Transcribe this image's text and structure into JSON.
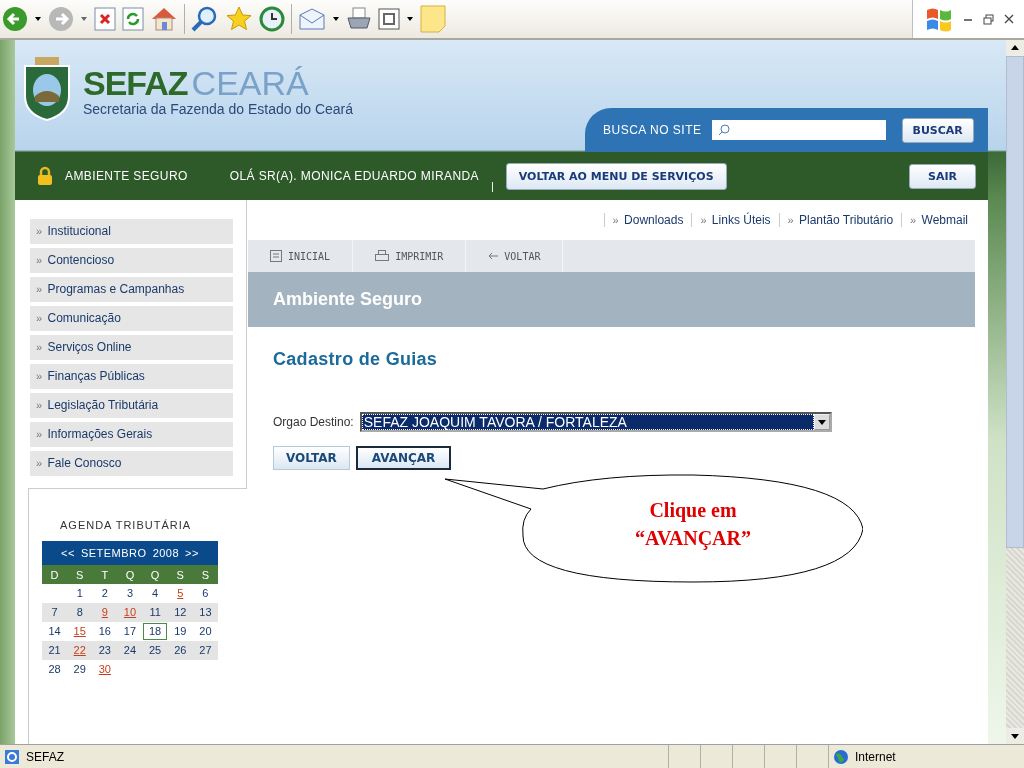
{
  "browser": {
    "status_text": "SEFAZ",
    "zone": "Internet"
  },
  "header": {
    "brand_bold": "SEFAZ",
    "brand_light": "CEARÁ",
    "subtitle": "Secretaria da Fazenda do Estado do Ceará",
    "search_label": "BUSCA NO SITE",
    "search_button": "BUSCAR"
  },
  "user_bar": {
    "secure_label": "AMBIENTE SEGURO",
    "greeting": "OLÁ SR(A). MONICA EDUARDO MIRANDA",
    "separator": "|",
    "menu_button": "VOLTAR AO MENU DE SERVIÇOS",
    "exit_button": "SAIR"
  },
  "sidebar": {
    "items": [
      {
        "marker": "»",
        "label": "Institucional"
      },
      {
        "marker": "»",
        "label": "Contencioso"
      },
      {
        "marker": "»",
        "label": "Programas e Campanhas"
      },
      {
        "marker": "»",
        "label": "Comunicação"
      },
      {
        "marker": "»",
        "label": "Serviços Online"
      },
      {
        "marker": "»",
        "label": "Finanças Públicas"
      },
      {
        "marker": "»",
        "label": "Legislação Tributária"
      },
      {
        "marker": "»",
        "label": "Informações Gerais"
      },
      {
        "marker": "»",
        "label": "Fale Conosco"
      }
    ]
  },
  "agenda": {
    "title": "AGENDA TRIBUTÁRIA",
    "prev": "<<",
    "month": "SETEMBRO",
    "year": "2008",
    "next": ">>",
    "weekdays": [
      "D",
      "S",
      "T",
      "Q",
      "Q",
      "S",
      "S"
    ],
    "weeks": [
      {
        "partial_start": true,
        "days": [
          {
            "day": "1",
            "marked": false,
            "today": false
          },
          {
            "day": "2",
            "marked": false,
            "today": false
          },
          {
            "day": "3",
            "marked": false,
            "today": false
          },
          {
            "day": "4",
            "marked": false,
            "today": false
          },
          {
            "day": "5",
            "marked": true,
            "today": false
          },
          {
            "day": "6",
            "marked": false,
            "today": false
          }
        ]
      },
      {
        "partial_start": false,
        "days": [
          {
            "day": "7",
            "marked": false,
            "today": false
          },
          {
            "day": "8",
            "marked": false,
            "today": false
          },
          {
            "day": "9",
            "marked": true,
            "today": false
          },
          {
            "day": "10",
            "marked": true,
            "today": false
          },
          {
            "day": "11",
            "marked": false,
            "today": false
          },
          {
            "day": "12",
            "marked": false,
            "today": false
          },
          {
            "day": "13",
            "marked": false,
            "today": false
          }
        ]
      },
      {
        "partial_start": false,
        "days": [
          {
            "day": "14",
            "marked": false,
            "today": false
          },
          {
            "day": "15",
            "marked": true,
            "today": false
          },
          {
            "day": "16",
            "marked": false,
            "today": false
          },
          {
            "day": "17",
            "marked": false,
            "today": false
          },
          {
            "day": "18",
            "marked": false,
            "today": true
          },
          {
            "day": "19",
            "marked": false,
            "today": false
          },
          {
            "day": "20",
            "marked": false,
            "today": false
          }
        ]
      },
      {
        "partial_start": false,
        "days": [
          {
            "day": "21",
            "marked": false,
            "today": false
          },
          {
            "day": "22",
            "marked": true,
            "today": false
          },
          {
            "day": "23",
            "marked": false,
            "today": false
          },
          {
            "day": "24",
            "marked": false,
            "today": false
          },
          {
            "day": "25",
            "marked": false,
            "today": false
          },
          {
            "day": "26",
            "marked": false,
            "today": false
          },
          {
            "day": "27",
            "marked": false,
            "today": false
          }
        ]
      },
      {
        "partial_start": false,
        "days": [
          {
            "day": "28",
            "marked": false,
            "today": false
          },
          {
            "day": "29",
            "marked": false,
            "today": false
          },
          {
            "day": "30",
            "marked": true,
            "today": false
          }
        ]
      }
    ]
  },
  "top_links": [
    {
      "marker": "»",
      "label": "Downloads"
    },
    {
      "marker": "»",
      "label": "Links Úteis"
    },
    {
      "marker": "»",
      "label": "Plantão Tributário"
    },
    {
      "marker": "»",
      "label": "Webmail"
    }
  ],
  "page_tools": [
    {
      "kind": "home",
      "label": "INICIAL"
    },
    {
      "kind": "print",
      "label": "IMPRIMIR"
    },
    {
      "kind": "back",
      "label": "VOLTAR"
    }
  ],
  "section_title": "Ambiente Seguro",
  "form": {
    "title": "Cadastro de Guias",
    "field_label": "Orgao Destino:",
    "field_value": "SEFAZ JOAQUIM TAVORA / FORTALEZA",
    "buttons": [
      {
        "label": "VOLTAR",
        "focused": false
      },
      {
        "label": "AVANÇAR",
        "focused": true
      }
    ]
  },
  "callout": {
    "lines": [
      "Clique em",
      "“AVANÇAR”"
    ]
  }
}
